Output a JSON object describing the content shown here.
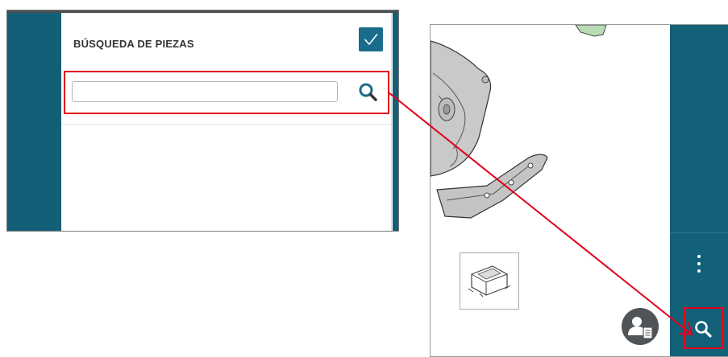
{
  "panel": {
    "title": "BÚSQUEDA DE PIEZAS",
    "confirm_icon": "checkmark-icon",
    "search_input": {
      "value": "",
      "placeholder": ""
    },
    "search_icon": "magnifier-icon"
  },
  "app": {
    "sidebar_menu_icon": "more-vertical-icon",
    "search_button_icon": "magnifier-icon",
    "user_button_icon": "user-document-icon",
    "thumbnail_icon": "control-unit-icon",
    "accent_color": "#136079",
    "highlight_color": "#e2001a"
  }
}
